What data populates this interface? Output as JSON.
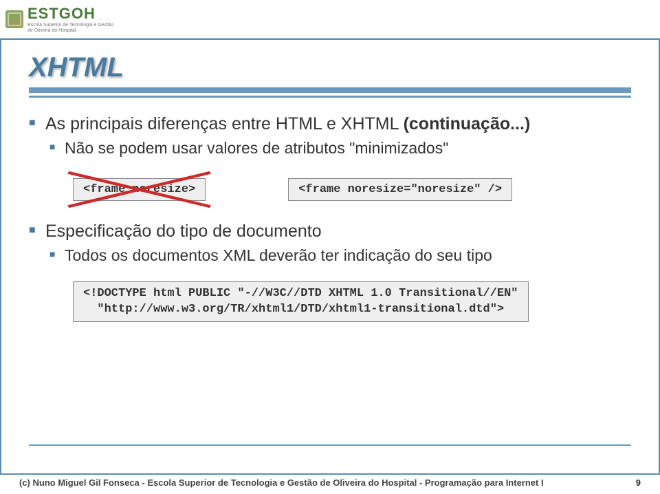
{
  "header": {
    "logo_text": "ESTGOH",
    "logo_sub1": "Escola Superior de Tecnologia e Gestão",
    "logo_sub2": "de Oliveira do Hospital"
  },
  "title": "XHTML",
  "content": {
    "line1_a": "As principais diferenças entre HTML e XHTML ",
    "line1_b": "(continuação...)",
    "line2": "Não se podem usar valores de atributos \"minimizados\""
  },
  "code": {
    "wrong": "<frame noresize>",
    "right": "<frame noresize=\"noresize\" />"
  },
  "spec": {
    "heading": "Especificação do tipo de documento",
    "sub": "Todos os documentos XML deverão ter indicação do seu tipo"
  },
  "doctype": "<!DOCTYPE html PUBLIC \"-//W3C//DTD XHTML 1.0 Transitional//EN\"\n  \"http://www.w3.org/TR/xhtml1/DTD/xhtml1-transitional.dtd\">",
  "footer": {
    "left": "(c) Nuno Miguel Gil Fonseca  -  Escola Superior de Tecnologia e Gestão de Oliveira do Hospital  -  Programação para Internet I",
    "page": "9"
  }
}
